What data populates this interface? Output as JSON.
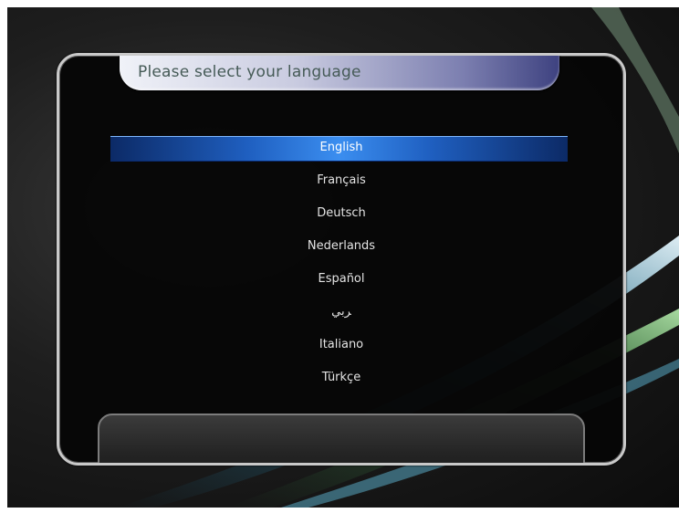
{
  "dialog": {
    "title": "Please select your language"
  },
  "languages": [
    {
      "label": "English",
      "selected": true
    },
    {
      "label": "Français",
      "selected": false
    },
    {
      "label": "Deutsch",
      "selected": false
    },
    {
      "label": "Nederlands",
      "selected": false
    },
    {
      "label": "Español",
      "selected": false
    },
    {
      "label": "ﺮﺑﻲ",
      "selected": false
    },
    {
      "label": "Italiano",
      "selected": false
    },
    {
      "label": "Türkçe",
      "selected": false
    }
  ],
  "colors": {
    "highlight": "#3b8ef0",
    "frame": "#c9c9c9",
    "title_text": "#465b57"
  }
}
